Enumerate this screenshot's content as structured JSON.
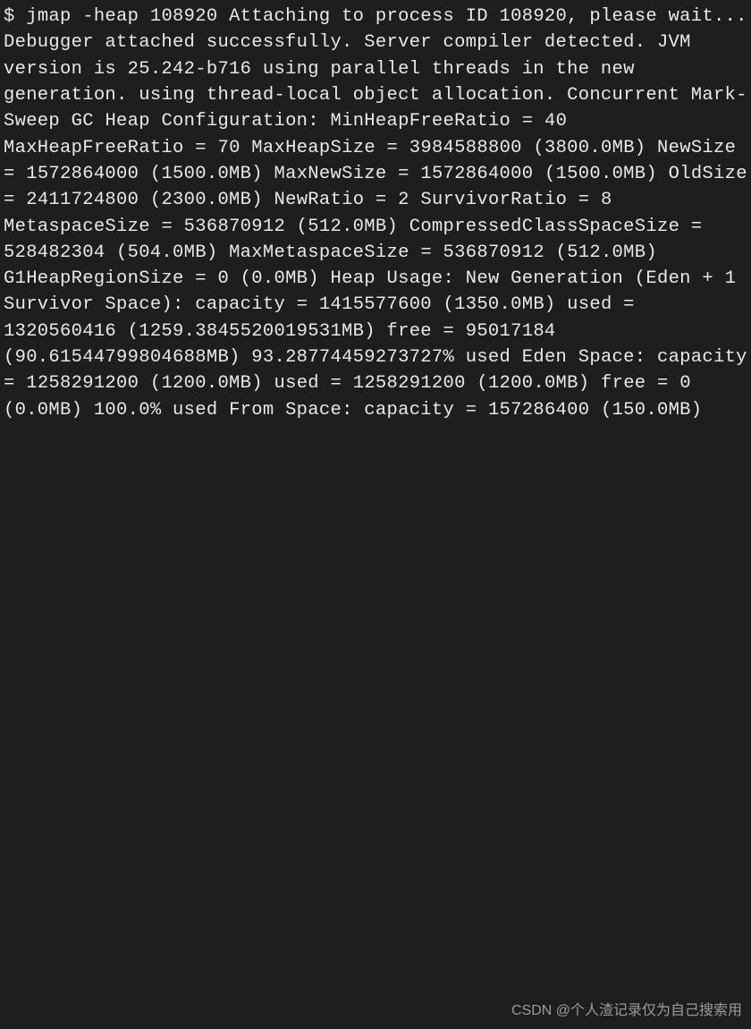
{
  "prompt": "$ ",
  "command": "jmap -heap 108920",
  "attach_lines": [
    "Attaching to process ID 108920, please wait...",
    "Debugger attached successfully.",
    "Server compiler detected.",
    "JVM version is 25.242-b716"
  ],
  "gc_lines": [
    "using parallel threads in the new generation.",
    "using thread-local object allocation.",
    "Concurrent Mark-Sweep GC"
  ],
  "heap_config_header": "Heap Configuration:",
  "heap_config": [
    {
      "key": "MinHeapFreeRatio",
      "pad": "        ",
      "val": "40"
    },
    {
      "key": "MaxHeapFreeRatio",
      "pad": "        ",
      "val": "70"
    },
    {
      "key": "MaxHeapSize",
      "pad": "             ",
      "val": "3984588800 (3800.0MB)"
    },
    {
      "key": "NewSize",
      "pad": "                 ",
      "val": "1572864000 (1500.0MB)"
    },
    {
      "key": "MaxNewSize",
      "pad": "              ",
      "val": "1572864000 (1500.0MB)"
    },
    {
      "key": "OldSize",
      "pad": "                 ",
      "val": "2411724800 (2300.0MB)"
    },
    {
      "key": "NewRatio",
      "pad": "                ",
      "val": "2"
    },
    {
      "key": "SurvivorRatio",
      "pad": "           ",
      "val": "8"
    },
    {
      "key": "MetaspaceSize",
      "pad": "           ",
      "val": "536870912 (512.0MB)"
    },
    {
      "key": "CompressedClassSpaceSize",
      "pad": "",
      "val": "528482304 (504.0MB)"
    },
    {
      "key": "MaxMetaspaceSize",
      "pad": "        ",
      "val": "536870912 (512.0MB)"
    },
    {
      "key": "G1HeapRegionSize",
      "pad": "        ",
      "val": "0 (0.0MB)"
    }
  ],
  "heap_usage_header": "Heap Usage:",
  "sections": [
    {
      "title": "New Generation (Eden + 1 Survivor Space):",
      "rows": [
        {
          "k": "capacity",
          "pad": "",
          "v": "1415577600 (1350.0MB)"
        },
        {
          "k": "used    ",
          "pad": "",
          "v": "1320560416 (1259.3845520019531MB)"
        },
        {
          "k": "free    ",
          "pad": "",
          "v": "95017184 (90.61544799804688MB)"
        }
      ],
      "pct": "93.28774459273727% used"
    },
    {
      "title": "Eden Space:",
      "rows": [
        {
          "k": "capacity",
          "pad": "",
          "v": "1258291200 (1200.0MB)"
        },
        {
          "k": "used    ",
          "pad": "",
          "v": "1258291200 (1200.0MB)"
        },
        {
          "k": "free    ",
          "pad": "",
          "v": "0 (0.0MB)"
        }
      ],
      "pct": "100.0% used"
    },
    {
      "title": "From Space:",
      "rows": [
        {
          "k": "capacity",
          "pad": "",
          "v": "157286400 (150.0MB)"
        }
      ],
      "pct": null
    }
  ],
  "watermark": "CSDN @个人渣记录仅为自己搜索用"
}
